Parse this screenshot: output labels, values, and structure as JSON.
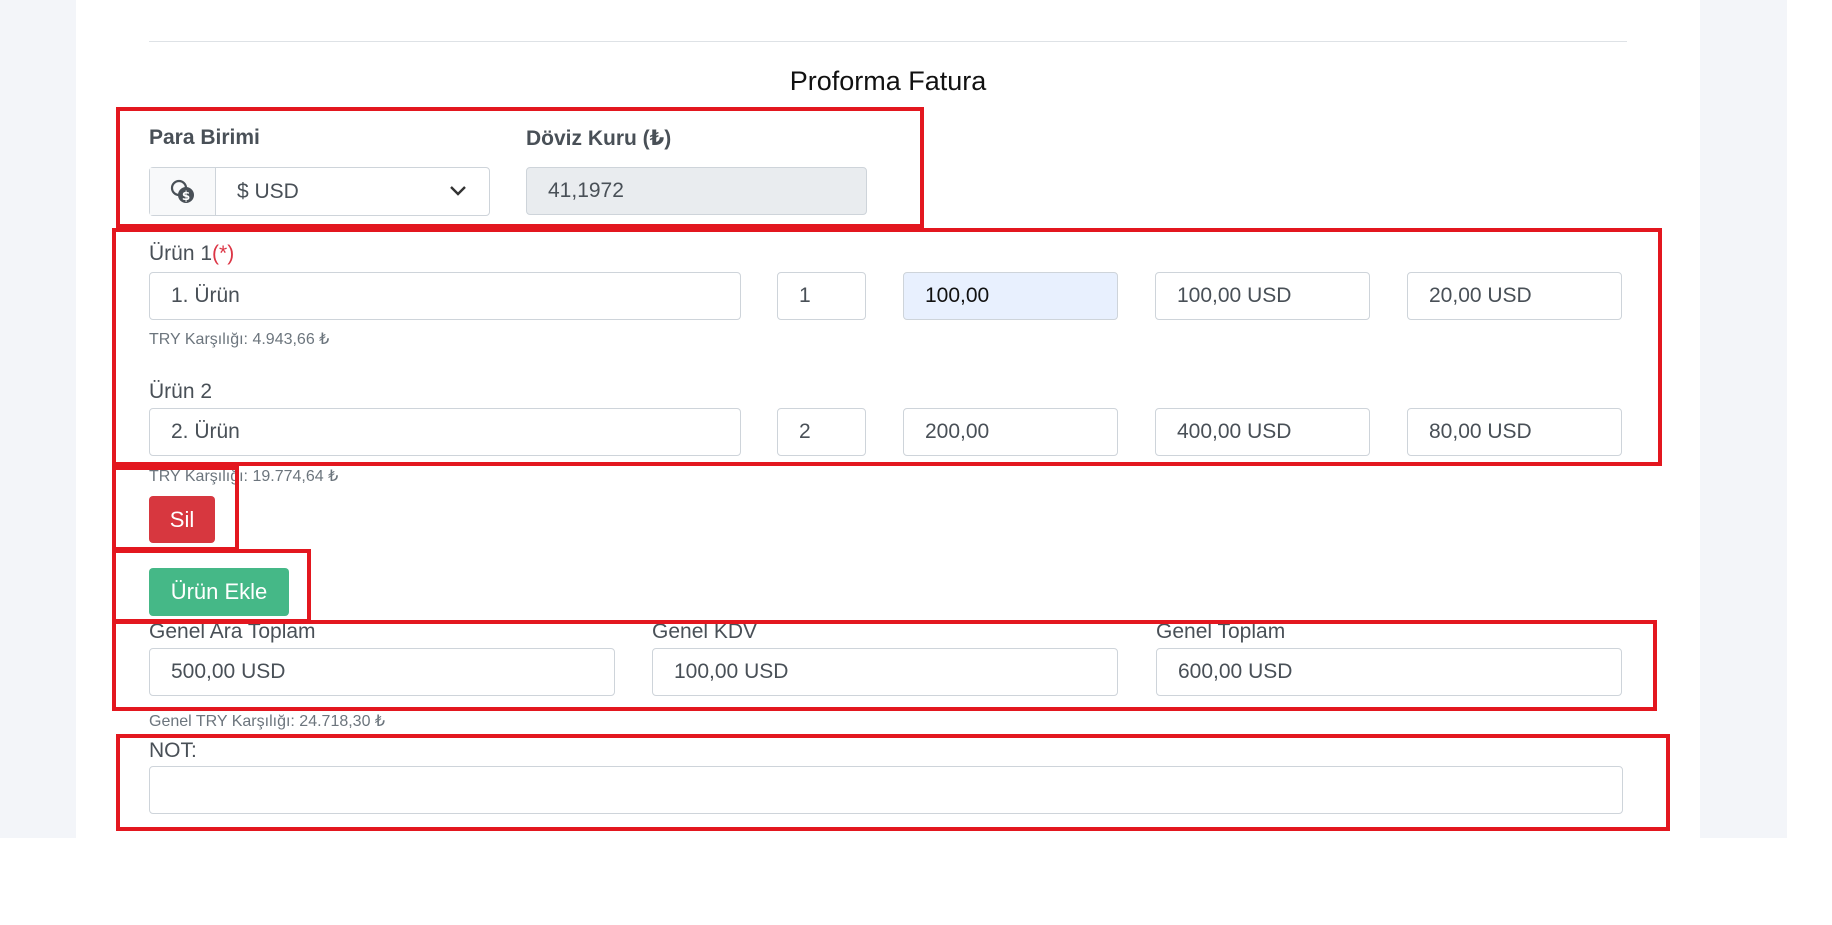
{
  "page": {
    "title": "Proforma Fatura"
  },
  "currency": {
    "label": "Para Birimi",
    "icon": "coins-dollar-icon",
    "selected": "$ USD",
    "rate_label": "Döviz Kuru (₺)",
    "rate_value": "41,1972"
  },
  "products": [
    {
      "label": "Ürün 1",
      "required_mark": "(*)",
      "name": "1. Ürün",
      "quantity": "1",
      "unit_price": "100,00",
      "line_total": "100,00 USD",
      "vat": "20,00 USD",
      "try_equivalent": "TRY Karşılığı: 4.943,66 ₺"
    },
    {
      "label": "Ürün 2",
      "name": "2. Ürün",
      "quantity": "2",
      "unit_price": "200,00",
      "line_total": "400,00 USD",
      "vat": "80,00 USD",
      "try_equivalent": "TRY Karşılığı: 19.774,64 ₺"
    }
  ],
  "buttons": {
    "delete": "Sil",
    "add_product": "Ürün Ekle"
  },
  "totals": {
    "subtotal_label": "Genel Ara Toplam",
    "subtotal": "500,00 USD",
    "vat_label": "Genel KDV",
    "vat": "100,00 USD",
    "total_label": "Genel Toplam",
    "total": "600,00 USD",
    "try_equivalent": "Genel TRY Karşılığı: 24.718,30 ₺"
  },
  "note": {
    "label": "NOT:",
    "value": ""
  },
  "colors": {
    "annotation": "#e3171f",
    "danger": "#d7373f",
    "success": "#45b887"
  }
}
